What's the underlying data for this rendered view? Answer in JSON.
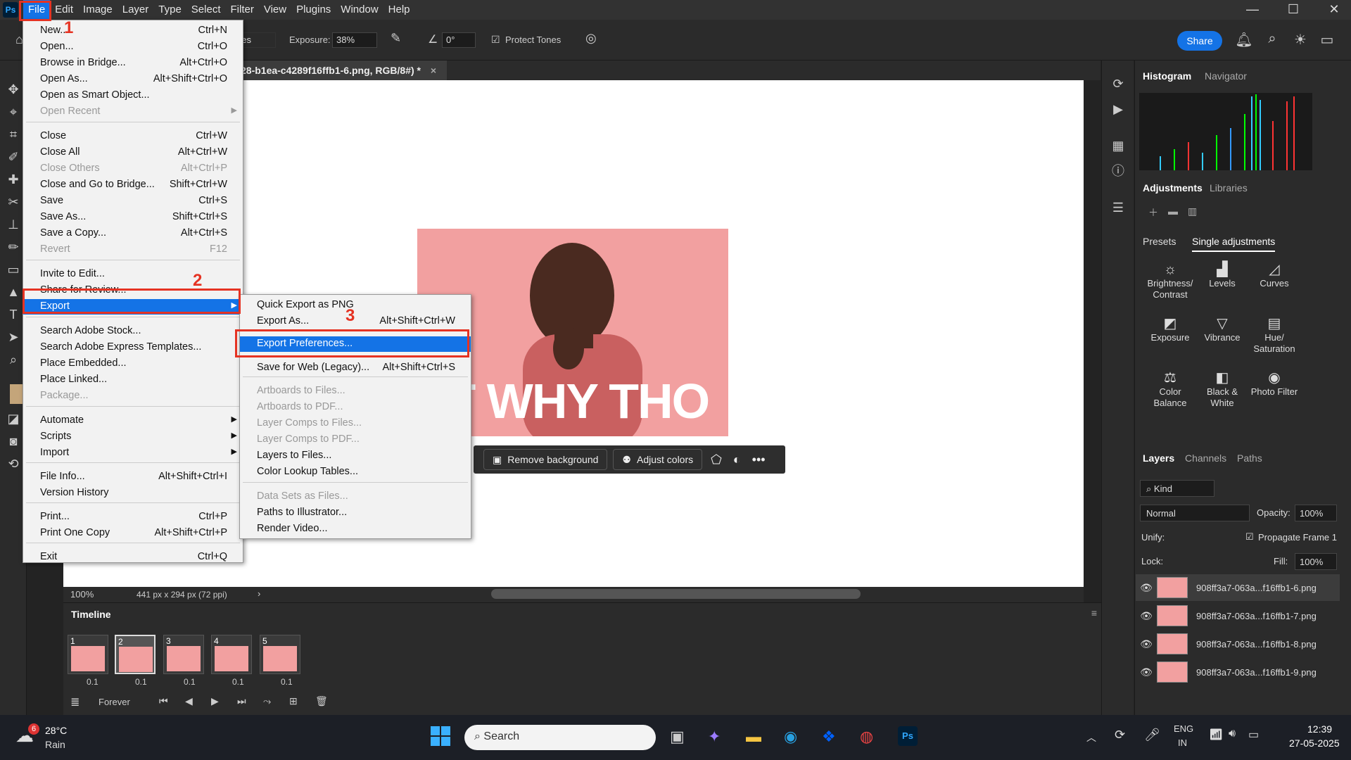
{
  "menubar": {
    "app_icon": "Ps",
    "items": [
      "File",
      "Edit",
      "Image",
      "Layer",
      "Type",
      "Select",
      "Filter",
      "View",
      "Plugins",
      "Window",
      "Help"
    ]
  },
  "options_bar": {
    "mode_partial": "nes",
    "exposure_label": "Exposure:",
    "exposure_value": "38%",
    "angle_value": "0°",
    "protect_tones": "Protect Tones",
    "share": "Share"
  },
  "document": {
    "tab_title": "28-b1ea-c4289f16ffb1-6.png, RGB/8#) *",
    "zoom": "100%",
    "dims": "441 px x 294 px (72 ppi)",
    "meme_text": "UT WHY THO"
  },
  "context_bar": {
    "remove_bg": "Remove background",
    "adjust_colors": "Adjust colors"
  },
  "file_menu": [
    {
      "label": "New...",
      "shortcut": "Ctrl+N"
    },
    {
      "label": "Open...",
      "shortcut": "Ctrl+O"
    },
    {
      "label": "Browse in Bridge...",
      "shortcut": "Alt+Ctrl+O"
    },
    {
      "label": "Open As...",
      "shortcut": "Alt+Shift+Ctrl+O"
    },
    {
      "label": "Open as Smart Object...",
      "shortcut": ""
    },
    {
      "label": "Open Recent",
      "shortcut": ""
    },
    {
      "label": "Close",
      "shortcut": "Ctrl+W"
    },
    {
      "label": "Close All",
      "shortcut": "Alt+Ctrl+W"
    },
    {
      "label": "Close Others",
      "shortcut": "Alt+Ctrl+P"
    },
    {
      "label": "Close and Go to Bridge...",
      "shortcut": "Shift+Ctrl+W"
    },
    {
      "label": "Save",
      "shortcut": "Ctrl+S"
    },
    {
      "label": "Save As...",
      "shortcut": "Shift+Ctrl+S"
    },
    {
      "label": "Save a Copy...",
      "shortcut": "Alt+Ctrl+S"
    },
    {
      "label": "Revert",
      "shortcut": "F12"
    },
    {
      "label": "Invite to Edit...",
      "shortcut": ""
    },
    {
      "label": "Share for Review...",
      "shortcut": ""
    },
    {
      "label": "Export",
      "shortcut": ""
    },
    {
      "label": "Search Adobe Stock...",
      "shortcut": ""
    },
    {
      "label": "Search Adobe Express Templates...",
      "shortcut": ""
    },
    {
      "label": "Place Embedded...",
      "shortcut": ""
    },
    {
      "label": "Place Linked...",
      "shortcut": ""
    },
    {
      "label": "Package...",
      "shortcut": ""
    },
    {
      "label": "Automate",
      "shortcut": ""
    },
    {
      "label": "Scripts",
      "shortcut": ""
    },
    {
      "label": "Import",
      "shortcut": ""
    },
    {
      "label": "File Info...",
      "shortcut": "Alt+Shift+Ctrl+I"
    },
    {
      "label": "Version History",
      "shortcut": ""
    },
    {
      "label": "Print...",
      "shortcut": "Ctrl+P"
    },
    {
      "label": "Print One Copy",
      "shortcut": "Alt+Shift+Ctrl+P"
    },
    {
      "label": "Exit",
      "shortcut": "Ctrl+Q"
    }
  ],
  "export_menu": [
    {
      "label": "Quick Export as PNG",
      "shortcut": ""
    },
    {
      "label": "Export As...",
      "shortcut": "Alt+Shift+Ctrl+W"
    },
    {
      "label": "Export Preferences...",
      "shortcut": ""
    },
    {
      "label": "Save for Web (Legacy)...",
      "shortcut": "Alt+Shift+Ctrl+S"
    },
    {
      "label": "Artboards to Files...",
      "shortcut": ""
    },
    {
      "label": "Artboards to PDF...",
      "shortcut": ""
    },
    {
      "label": "Layer Comps to Files...",
      "shortcut": ""
    },
    {
      "label": "Layer Comps to PDF...",
      "shortcut": ""
    },
    {
      "label": "Layers to Files...",
      "shortcut": ""
    },
    {
      "label": "Color Lookup Tables...",
      "shortcut": ""
    },
    {
      "label": "Data Sets as Files...",
      "shortcut": ""
    },
    {
      "label": "Paths to Illustrator...",
      "shortcut": ""
    },
    {
      "label": "Render Video...",
      "shortcut": ""
    }
  ],
  "annotations": [
    "1",
    "2",
    "3"
  ],
  "panels": {
    "histogram_tab": "Histogram",
    "navigator_tab": "Navigator",
    "adjustments_tab": "Adjustments",
    "libraries_tab": "Libraries",
    "presets_tab": "Presets",
    "single_adj_tab": "Single adjustments",
    "adj_items": [
      {
        "label": "Brightness/ Contrast",
        "icon": "☼"
      },
      {
        "label": "Levels",
        "icon": "▟"
      },
      {
        "label": "Curves",
        "icon": "◿"
      },
      {
        "label": "Exposure",
        "icon": "◩"
      },
      {
        "label": "Vibrance",
        "icon": "▽"
      },
      {
        "label": "Hue/ Saturation",
        "icon": "▤"
      },
      {
        "label": "Color Balance",
        "icon": "⚖"
      },
      {
        "label": "Black & White",
        "icon": "◧"
      },
      {
        "label": "Photo Filter",
        "icon": "◉"
      }
    ],
    "layers_tab": "Layers",
    "channels_tab": "Channels",
    "paths_tab": "Paths",
    "kind": "Kind",
    "blend_mode": "Normal",
    "opacity_label": "Opacity:",
    "opacity": "100%",
    "unify_label": "Unify:",
    "propagate": "Propagate Frame 1",
    "lock_label": "Lock:",
    "fill_label": "Fill:",
    "fill": "100%",
    "layers": [
      "908ff3a7-063a...f16ffb1-6.png",
      "908ff3a7-063a...f16ffb1-7.png",
      "908ff3a7-063a...f16ffb1-8.png",
      "908ff3a7-063a...f16ffb1-9.png"
    ]
  },
  "timeline": {
    "title": "Timeline",
    "frames": [
      "1",
      "2",
      "3",
      "4",
      "5"
    ],
    "delays": [
      "0.1",
      "0.1",
      "0.1",
      "0.1",
      "0.1"
    ],
    "loop": "Forever"
  },
  "taskbar": {
    "weather_badge": "6",
    "temp": "28°C",
    "weather": "Rain",
    "search": "Search",
    "lang1": "ENG",
    "lang2": "IN",
    "time": "12:39",
    "date": "27-05-2025"
  },
  "colors": {
    "accent": "#1473e6",
    "annotation": "#e53323",
    "meme_bg": "#f2a0a0"
  }
}
